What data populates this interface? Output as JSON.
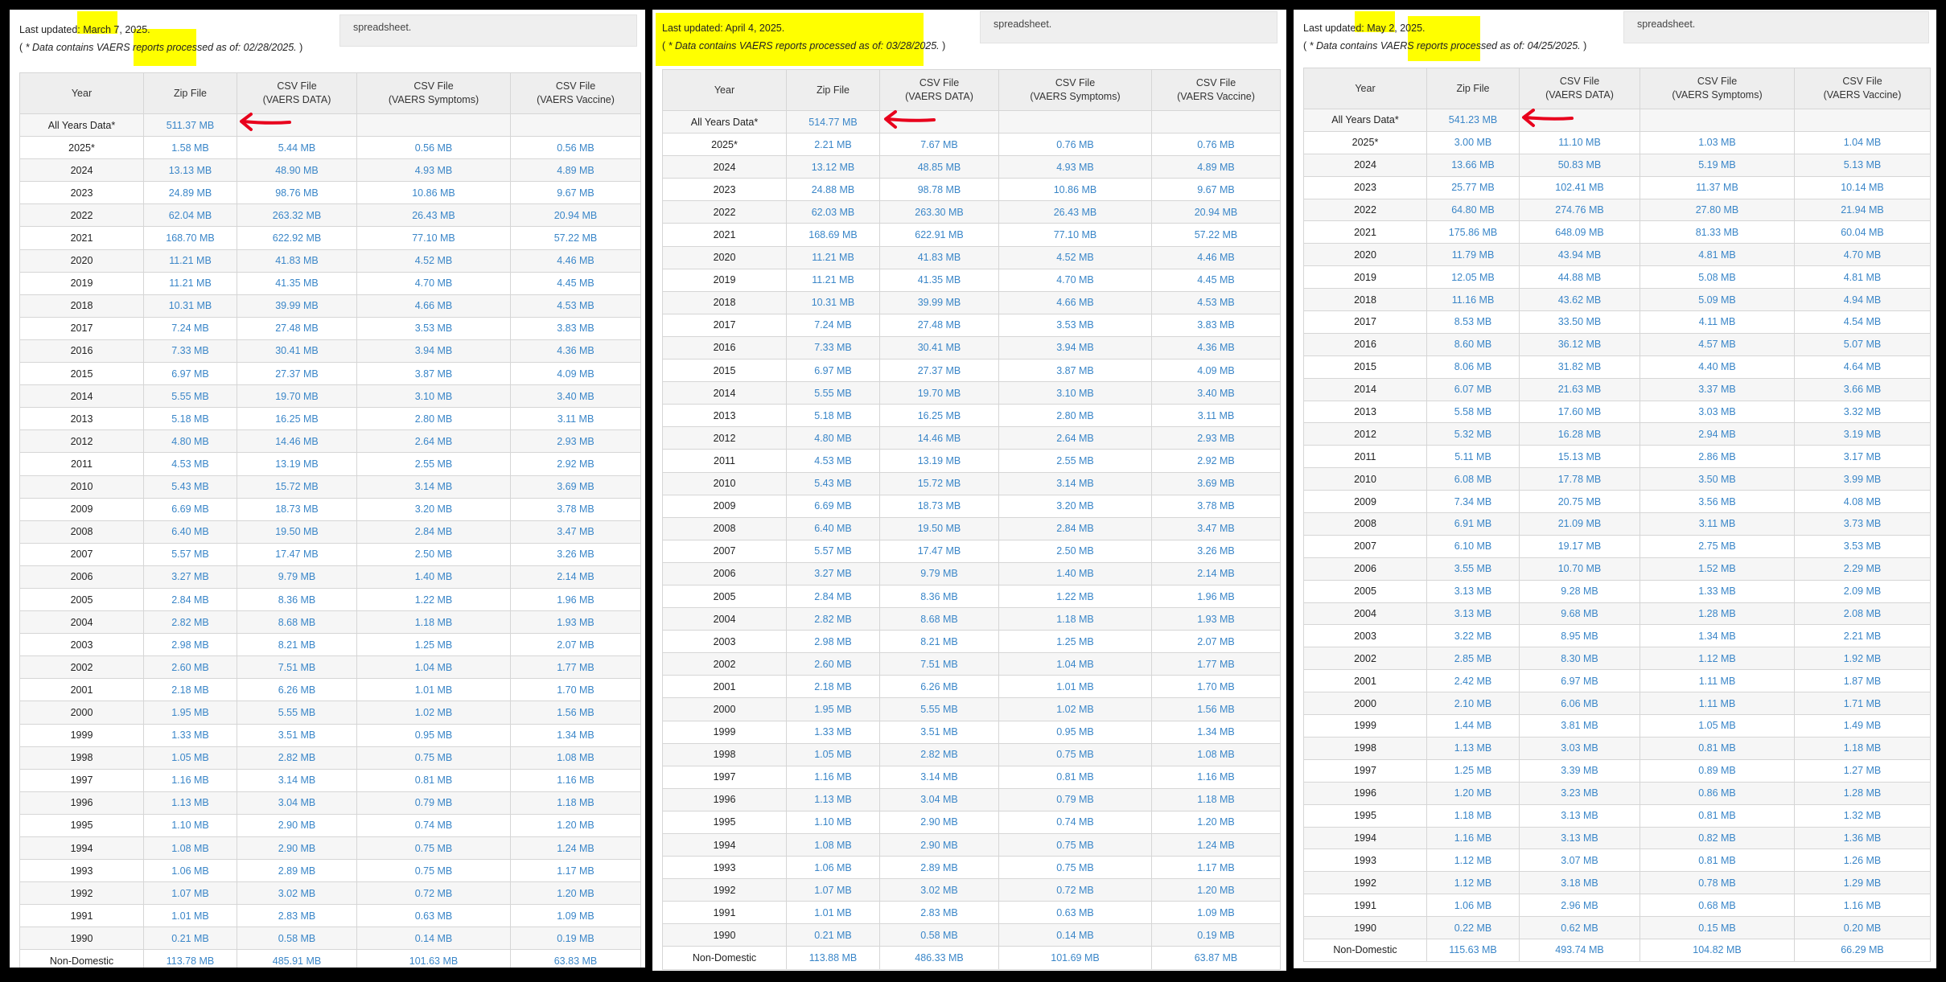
{
  "headers": [
    "Year",
    "Zip File",
    "CSV File\n(VAERS DATA)",
    "CSV File\n(VAERS Symptoms)",
    "CSV File\n(VAERS Vaccine)"
  ],
  "years": [
    "All Years Data*",
    "2025*",
    "2024",
    "2023",
    "2022",
    "2021",
    "2020",
    "2019",
    "2018",
    "2017",
    "2016",
    "2015",
    "2014",
    "2013",
    "2012",
    "2011",
    "2010",
    "2009",
    "2008",
    "2007",
    "2006",
    "2005",
    "2004",
    "2003",
    "2002",
    "2001",
    "2000",
    "1999",
    "1998",
    "1997",
    "1996",
    "1995",
    "1994",
    "1993",
    "1992",
    "1991",
    "1990",
    "Non-Domestic"
  ],
  "colors": {
    "highlight": "#ffff00",
    "link": "#3a86c8",
    "arrow": "#e8001c",
    "background": "#000000"
  },
  "icons": [
    "red-arrow-icon"
  ],
  "panels": [
    {
      "updated_label": "Last updated: ",
      "updated_date": "March 7, 2025.",
      "note_open": "( ",
      "note_text": "* Data contains VAERS reports processed as of: ",
      "note_date": "02/28/2025.",
      "note_close": " )",
      "box_text": "spreadsheet.",
      "rows": [
        [
          "511.37 MB",
          "",
          "",
          ""
        ],
        [
          "1.58 MB",
          "5.44 MB",
          "0.56 MB",
          "0.56 MB"
        ],
        [
          "13.13 MB",
          "48.90 MB",
          "4.93 MB",
          "4.89 MB"
        ],
        [
          "24.89 MB",
          "98.76 MB",
          "10.86 MB",
          "9.67 MB"
        ],
        [
          "62.04 MB",
          "263.32 MB",
          "26.43 MB",
          "20.94 MB"
        ],
        [
          "168.70 MB",
          "622.92 MB",
          "77.10 MB",
          "57.22 MB"
        ],
        [
          "11.21 MB",
          "41.83 MB",
          "4.52 MB",
          "4.46 MB"
        ],
        [
          "11.21 MB",
          "41.35 MB",
          "4.70 MB",
          "4.45 MB"
        ],
        [
          "10.31 MB",
          "39.99 MB",
          "4.66 MB",
          "4.53 MB"
        ],
        [
          "7.24 MB",
          "27.48 MB",
          "3.53 MB",
          "3.83 MB"
        ],
        [
          "7.33 MB",
          "30.41 MB",
          "3.94 MB",
          "4.36 MB"
        ],
        [
          "6.97 MB",
          "27.37 MB",
          "3.87 MB",
          "4.09 MB"
        ],
        [
          "5.55 MB",
          "19.70 MB",
          "3.10 MB",
          "3.40 MB"
        ],
        [
          "5.18 MB",
          "16.25 MB",
          "2.80 MB",
          "3.11 MB"
        ],
        [
          "4.80 MB",
          "14.46 MB",
          "2.64 MB",
          "2.93 MB"
        ],
        [
          "4.53 MB",
          "13.19 MB",
          "2.55 MB",
          "2.92 MB"
        ],
        [
          "5.43 MB",
          "15.72 MB",
          "3.14 MB",
          "3.69 MB"
        ],
        [
          "6.69 MB",
          "18.73 MB",
          "3.20 MB",
          "3.78 MB"
        ],
        [
          "6.40 MB",
          "19.50 MB",
          "2.84 MB",
          "3.47 MB"
        ],
        [
          "5.57 MB",
          "17.47 MB",
          "2.50 MB",
          "3.26 MB"
        ],
        [
          "3.27 MB",
          "9.79 MB",
          "1.40 MB",
          "2.14 MB"
        ],
        [
          "2.84 MB",
          "8.36 MB",
          "1.22 MB",
          "1.96 MB"
        ],
        [
          "2.82 MB",
          "8.68 MB",
          "1.18 MB",
          "1.93 MB"
        ],
        [
          "2.98 MB",
          "8.21 MB",
          "1.25 MB",
          "2.07 MB"
        ],
        [
          "2.60 MB",
          "7.51 MB",
          "1.04 MB",
          "1.77 MB"
        ],
        [
          "2.18 MB",
          "6.26 MB",
          "1.01 MB",
          "1.70 MB"
        ],
        [
          "1.95 MB",
          "5.55 MB",
          "1.02 MB",
          "1.56 MB"
        ],
        [
          "1.33 MB",
          "3.51 MB",
          "0.95 MB",
          "1.34 MB"
        ],
        [
          "1.05 MB",
          "2.82 MB",
          "0.75 MB",
          "1.08 MB"
        ],
        [
          "1.16 MB",
          "3.14 MB",
          "0.81 MB",
          "1.16 MB"
        ],
        [
          "1.13 MB",
          "3.04 MB",
          "0.79 MB",
          "1.18 MB"
        ],
        [
          "1.10 MB",
          "2.90 MB",
          "0.74 MB",
          "1.20 MB"
        ],
        [
          "1.08 MB",
          "2.90 MB",
          "0.75 MB",
          "1.24 MB"
        ],
        [
          "1.06 MB",
          "2.89 MB",
          "0.75 MB",
          "1.17 MB"
        ],
        [
          "1.07 MB",
          "3.02 MB",
          "0.72 MB",
          "1.20 MB"
        ],
        [
          "1.01 MB",
          "2.83 MB",
          "0.63 MB",
          "1.09 MB"
        ],
        [
          "0.21 MB",
          "0.58 MB",
          "0.14 MB",
          "0.19 MB"
        ],
        [
          "113.78 MB",
          "485.91 MB",
          "101.63 MB",
          "63.83 MB"
        ]
      ]
    },
    {
      "updated_label": "Last updated: ",
      "updated_date": "April 4, 2025.",
      "note_open": "( ",
      "note_text": "* Data contains VAERS reports processed as of: ",
      "note_date": "03/28/2025.",
      "note_close": " )",
      "box_text": "spreadsheet.",
      "rows": [
        [
          "514.77 MB",
          "",
          "",
          ""
        ],
        [
          "2.21 MB",
          "7.67 MB",
          "0.76 MB",
          "0.76 MB"
        ],
        [
          "13.12 MB",
          "48.85 MB",
          "4.93 MB",
          "4.89 MB"
        ],
        [
          "24.88 MB",
          "98.78 MB",
          "10.86 MB",
          "9.67 MB"
        ],
        [
          "62.03 MB",
          "263.30 MB",
          "26.43 MB",
          "20.94 MB"
        ],
        [
          "168.69 MB",
          "622.91 MB",
          "77.10 MB",
          "57.22 MB"
        ],
        [
          "11.21 MB",
          "41.83 MB",
          "4.52 MB",
          "4.46 MB"
        ],
        [
          "11.21 MB",
          "41.35 MB",
          "4.70 MB",
          "4.45 MB"
        ],
        [
          "10.31 MB",
          "39.99 MB",
          "4.66 MB",
          "4.53 MB"
        ],
        [
          "7.24 MB",
          "27.48 MB",
          "3.53 MB",
          "3.83 MB"
        ],
        [
          "7.33 MB",
          "30.41 MB",
          "3.94 MB",
          "4.36 MB"
        ],
        [
          "6.97 MB",
          "27.37 MB",
          "3.87 MB",
          "4.09 MB"
        ],
        [
          "5.55 MB",
          "19.70 MB",
          "3.10 MB",
          "3.40 MB"
        ],
        [
          "5.18 MB",
          "16.25 MB",
          "2.80 MB",
          "3.11 MB"
        ],
        [
          "4.80 MB",
          "14.46 MB",
          "2.64 MB",
          "2.93 MB"
        ],
        [
          "4.53 MB",
          "13.19 MB",
          "2.55 MB",
          "2.92 MB"
        ],
        [
          "5.43 MB",
          "15.72 MB",
          "3.14 MB",
          "3.69 MB"
        ],
        [
          "6.69 MB",
          "18.73 MB",
          "3.20 MB",
          "3.78 MB"
        ],
        [
          "6.40 MB",
          "19.50 MB",
          "2.84 MB",
          "3.47 MB"
        ],
        [
          "5.57 MB",
          "17.47 MB",
          "2.50 MB",
          "3.26 MB"
        ],
        [
          "3.27 MB",
          "9.79 MB",
          "1.40 MB",
          "2.14 MB"
        ],
        [
          "2.84 MB",
          "8.36 MB",
          "1.22 MB",
          "1.96 MB"
        ],
        [
          "2.82 MB",
          "8.68 MB",
          "1.18 MB",
          "1.93 MB"
        ],
        [
          "2.98 MB",
          "8.21 MB",
          "1.25 MB",
          "2.07 MB"
        ],
        [
          "2.60 MB",
          "7.51 MB",
          "1.04 MB",
          "1.77 MB"
        ],
        [
          "2.18 MB",
          "6.26 MB",
          "1.01 MB",
          "1.70 MB"
        ],
        [
          "1.95 MB",
          "5.55 MB",
          "1.02 MB",
          "1.56 MB"
        ],
        [
          "1.33 MB",
          "3.51 MB",
          "0.95 MB",
          "1.34 MB"
        ],
        [
          "1.05 MB",
          "2.82 MB",
          "0.75 MB",
          "1.08 MB"
        ],
        [
          "1.16 MB",
          "3.14 MB",
          "0.81 MB",
          "1.16 MB"
        ],
        [
          "1.13 MB",
          "3.04 MB",
          "0.79 MB",
          "1.18 MB"
        ],
        [
          "1.10 MB",
          "2.90 MB",
          "0.74 MB",
          "1.20 MB"
        ],
        [
          "1.08 MB",
          "2.90 MB",
          "0.75 MB",
          "1.24 MB"
        ],
        [
          "1.06 MB",
          "2.89 MB",
          "0.75 MB",
          "1.17 MB"
        ],
        [
          "1.07 MB",
          "3.02 MB",
          "0.72 MB",
          "1.20 MB"
        ],
        [
          "1.01 MB",
          "2.83 MB",
          "0.63 MB",
          "1.09 MB"
        ],
        [
          "0.21 MB",
          "0.58 MB",
          "0.14 MB",
          "0.19 MB"
        ],
        [
          "113.88 MB",
          "486.33 MB",
          "101.69 MB",
          "63.87 MB"
        ]
      ]
    },
    {
      "updated_label": "Last updated: ",
      "updated_date": "May 2, 2025.",
      "note_open": "( ",
      "note_text": "* Data contains VAERS reports processed as of: ",
      "note_date": "04/25/2025.",
      "note_close": " )",
      "box_text": "spreadsheet.",
      "rows": [
        [
          "541.23 MB",
          "",
          "",
          ""
        ],
        [
          "3.00 MB",
          "11.10 MB",
          "1.03 MB",
          "1.04 MB"
        ],
        [
          "13.66 MB",
          "50.83 MB",
          "5.19 MB",
          "5.13 MB"
        ],
        [
          "25.77 MB",
          "102.41 MB",
          "11.37 MB",
          "10.14 MB"
        ],
        [
          "64.80 MB",
          "274.76 MB",
          "27.80 MB",
          "21.94 MB"
        ],
        [
          "175.86 MB",
          "648.09 MB",
          "81.33 MB",
          "60.04 MB"
        ],
        [
          "11.79 MB",
          "43.94 MB",
          "4.81 MB",
          "4.70 MB"
        ],
        [
          "12.05 MB",
          "44.88 MB",
          "5.08 MB",
          "4.81 MB"
        ],
        [
          "11.16 MB",
          "43.62 MB",
          "5.09 MB",
          "4.94 MB"
        ],
        [
          "8.53 MB",
          "33.50 MB",
          "4.11 MB",
          "4.54 MB"
        ],
        [
          "8.60 MB",
          "36.12 MB",
          "4.57 MB",
          "5.07 MB"
        ],
        [
          "8.06 MB",
          "31.82 MB",
          "4.40 MB",
          "4.64 MB"
        ],
        [
          "6.07 MB",
          "21.63 MB",
          "3.37 MB",
          "3.66 MB"
        ],
        [
          "5.58 MB",
          "17.60 MB",
          "3.03 MB",
          "3.32 MB"
        ],
        [
          "5.32 MB",
          "16.28 MB",
          "2.94 MB",
          "3.19 MB"
        ],
        [
          "5.11 MB",
          "15.13 MB",
          "2.86 MB",
          "3.17 MB"
        ],
        [
          "6.08 MB",
          "17.78 MB",
          "3.50 MB",
          "3.99 MB"
        ],
        [
          "7.34 MB",
          "20.75 MB",
          "3.56 MB",
          "4.08 MB"
        ],
        [
          "6.91 MB",
          "21.09 MB",
          "3.11 MB",
          "3.73 MB"
        ],
        [
          "6.10 MB",
          "19.17 MB",
          "2.75 MB",
          "3.53 MB"
        ],
        [
          "3.55 MB",
          "10.70 MB",
          "1.52 MB",
          "2.29 MB"
        ],
        [
          "3.13 MB",
          "9.28 MB",
          "1.33 MB",
          "2.09 MB"
        ],
        [
          "3.13 MB",
          "9.68 MB",
          "1.28 MB",
          "2.08 MB"
        ],
        [
          "3.22 MB",
          "8.95 MB",
          "1.34 MB",
          "2.21 MB"
        ],
        [
          "2.85 MB",
          "8.30 MB",
          "1.12 MB",
          "1.92 MB"
        ],
        [
          "2.42 MB",
          "6.97 MB",
          "1.11 MB",
          "1.87 MB"
        ],
        [
          "2.10 MB",
          "6.06 MB",
          "1.11 MB",
          "1.71 MB"
        ],
        [
          "1.44 MB",
          "3.81 MB",
          "1.05 MB",
          "1.49 MB"
        ],
        [
          "1.13 MB",
          "3.03 MB",
          "0.81 MB",
          "1.18 MB"
        ],
        [
          "1.25 MB",
          "3.39 MB",
          "0.89 MB",
          "1.27 MB"
        ],
        [
          "1.20 MB",
          "3.23 MB",
          "0.86 MB",
          "1.28 MB"
        ],
        [
          "1.18 MB",
          "3.13 MB",
          "0.81 MB",
          "1.32 MB"
        ],
        [
          "1.16 MB",
          "3.13 MB",
          "0.82 MB",
          "1.36 MB"
        ],
        [
          "1.12 MB",
          "3.07 MB",
          "0.81 MB",
          "1.26 MB"
        ],
        [
          "1.12 MB",
          "3.18 MB",
          "0.78 MB",
          "1.29 MB"
        ],
        [
          "1.06 MB",
          "2.96 MB",
          "0.68 MB",
          "1.16 MB"
        ],
        [
          "0.22 MB",
          "0.62 MB",
          "0.15 MB",
          "0.20 MB"
        ],
        [
          "115.63 MB",
          "493.74 MB",
          "104.82 MB",
          "66.29 MB"
        ]
      ]
    }
  ]
}
